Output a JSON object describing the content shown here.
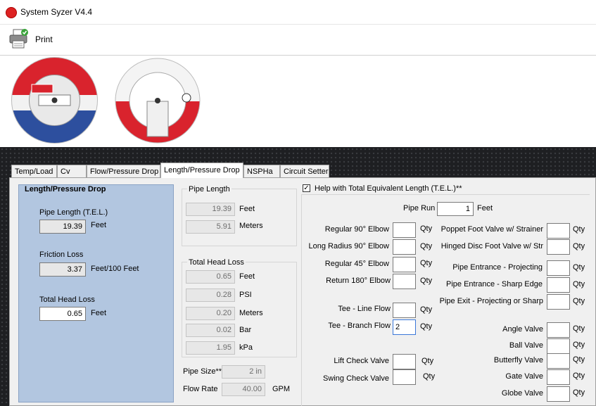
{
  "window": {
    "title": "System Syzer V4.4"
  },
  "toolbar": {
    "print_label": "Print"
  },
  "tabs": [
    {
      "label": "Temp/Load"
    },
    {
      "label": "Cv"
    },
    {
      "label": "Flow/Pressure Drop"
    },
    {
      "label": "Length/Pressure Drop"
    },
    {
      "label": "NSPHa"
    },
    {
      "label": "Circuit Setter"
    }
  ],
  "length_pressure": {
    "title": "Length/Pressure Drop",
    "pipe_length_label": "Pipe Length (T.E.L.)",
    "pipe_length_value": "19.39",
    "pipe_length_unit": "Feet",
    "friction_loss_label": "Friction Loss",
    "friction_loss_value": "3.37",
    "friction_loss_unit": "Feet/100 Feet",
    "total_head_loss_label": "Total Head Loss",
    "total_head_loss_value": "0.65",
    "total_head_loss_unit": "Feet"
  },
  "pipe_length": {
    "title": "Pipe Length",
    "feet_value": "19.39",
    "feet_unit": "Feet",
    "meters_value": "5.91",
    "meters_unit": "Meters"
  },
  "total_head_loss": {
    "title": "Total Head Loss",
    "rows": [
      {
        "value": "0.65",
        "unit": "Feet"
      },
      {
        "value": "0.28",
        "unit": "PSI"
      },
      {
        "value": "0.20",
        "unit": "Meters"
      },
      {
        "value": "0.02",
        "unit": "Bar"
      },
      {
        "value": "1.95",
        "unit": "kPa"
      }
    ]
  },
  "pipe_size": {
    "label": "Pipe Size**",
    "value": "2 in"
  },
  "flow_rate": {
    "label": "Flow Rate",
    "value": "40.00",
    "unit": "GPM"
  },
  "tel_help": {
    "checkbox_label": "Help with Total Equivalent Length (T.E.L.)**",
    "checked": true,
    "pipe_run_label": "Pipe Run",
    "pipe_run_value": "1",
    "pipe_run_unit": "Feet",
    "qty_label": "Qty",
    "left_fittings": [
      {
        "label": "Regular 90° Elbow",
        "value": ""
      },
      {
        "label": "Long Radius 90° Elbow",
        "value": ""
      },
      {
        "label": "Regular 45° Elbow",
        "value": ""
      },
      {
        "label": "Return 180° Elbow",
        "value": ""
      },
      {
        "label": "Tee - Line Flow",
        "value": ""
      },
      {
        "label": "Tee - Branch Flow",
        "value": "2"
      },
      {
        "label": "Lift Check Valve",
        "value": ""
      },
      {
        "label": "Swing Check Valve",
        "value": ""
      }
    ],
    "right_fittings": [
      {
        "label": "Poppet Foot Valve w/ Strainer",
        "value": ""
      },
      {
        "label": "Hinged Disc Foot Valve w/ Str",
        "value": ""
      },
      {
        "label": "Pipe Entrance - Projecting",
        "value": ""
      },
      {
        "label": "Pipe Entrance -  Sharp Edge",
        "value": ""
      },
      {
        "label": "Pipe Exit -  Projecting or Sharp",
        "value": ""
      },
      {
        "label": "Angle Valve",
        "value": ""
      },
      {
        "label": "Ball Valve",
        "value": ""
      },
      {
        "label": "Butterfly Valve",
        "value": ""
      },
      {
        "label": "Gate Valve",
        "value": ""
      },
      {
        "label": "Globe Valve",
        "value": ""
      }
    ]
  },
  "colors": {
    "accent_red": "#d9232d",
    "panel_blue": "#b2c6e0",
    "dark_band": "#1e1f22"
  }
}
